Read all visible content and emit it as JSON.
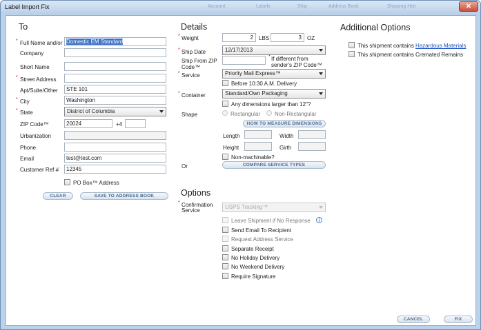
{
  "window": {
    "title": "Label Import Fix",
    "close_glyph": "✕",
    "background_toolbar": [
      "Account",
      "Labels",
      "Ship",
      "Address Book",
      "Shipping Hist"
    ]
  },
  "to": {
    "heading": "To",
    "full_name_label": "Full Name and/or",
    "full_name_value": "Domestic EM Standard",
    "company_label": "Company",
    "short_name_label": "Short Name",
    "street_label": "Street Address",
    "apt_label": "Apt/Suite/Other",
    "apt_value": "STE 101",
    "city_label": "City",
    "city_value": "Washington",
    "state_label": "State",
    "state_value": "District of Columbia",
    "zip_label": "ZIP Code™",
    "zip_value": "20024",
    "zip4_label": "+4",
    "urbanization_label": "Urbanization",
    "phone_label": "Phone",
    "email_label": "Email",
    "email_value": "test@test.com",
    "customer_ref_label": "Customer Ref #",
    "customer_ref_value": "12345",
    "po_box_label": "PO Box™ Address",
    "clear_button": "CLEAR",
    "save_button": "SAVE TO ADDRESS BOOK"
  },
  "details": {
    "heading": "Details",
    "weight_label": "Weight",
    "weight_lbs": "2",
    "lbs_label": "LBS",
    "weight_oz": "3",
    "oz_label": "OZ",
    "ship_date_label": "Ship Date",
    "ship_date_value": "12/17/2013",
    "ship_from_zip_label_1": "Ship From ZIP",
    "ship_from_zip_label_2": "Code™",
    "if_different_1": "If different from",
    "if_different_2": "sender's ZIP Code™",
    "service_label": "Service",
    "service_value": "Priority Mail Express™",
    "before_1030_label": "Before 10:30 A.M. Delivery",
    "container_label": "Container",
    "container_value": "Standard/Own Packaging",
    "any_dimensions_label": "Any dimensions larger than 12\"?",
    "shape_label": "Shape",
    "rectangular_label": "Rectangular",
    "non_rectangular_label": "Non-Rectangular",
    "how_to_measure_button": "HOW TO MEASURE DIMENSIONS",
    "length_label": "Length",
    "width_label": "Width",
    "height_label": "Height",
    "girth_label": "Girth",
    "non_machinable_label": "Non-machinable?",
    "or_label": "Or",
    "compare_button": "COMPARE SERVICE TYPES"
  },
  "options": {
    "heading": "Options",
    "confirmation_label_1": "Confirmation",
    "confirmation_label_2": "Service",
    "confirmation_value": "USPS Tracking™",
    "leave_shipment_label": "Leave Shipment if No Response",
    "send_email_label": "Send Email To Recipient",
    "request_address_label": "Request Address Service",
    "separate_receipt_label": "Separate Receipt",
    "no_holiday_label": "No Holiday Delivery",
    "no_weekend_label": "No Weekend Delivery",
    "require_signature_label": "Require Signature"
  },
  "additional": {
    "heading": "Additional Options",
    "hazardous_prefix": "This shipment contains ",
    "hazardous_link": "Hazardous Materials",
    "cremated_label": "This shipment contains Cremated Remains"
  },
  "footer": {
    "cancel_button": "CANCEL",
    "fix_button": "FIX"
  },
  "colors": {
    "accent": "#3a6fc4",
    "required": "#cc0000",
    "button_text": "#4a6a92",
    "frame": "#bcd2ea"
  }
}
